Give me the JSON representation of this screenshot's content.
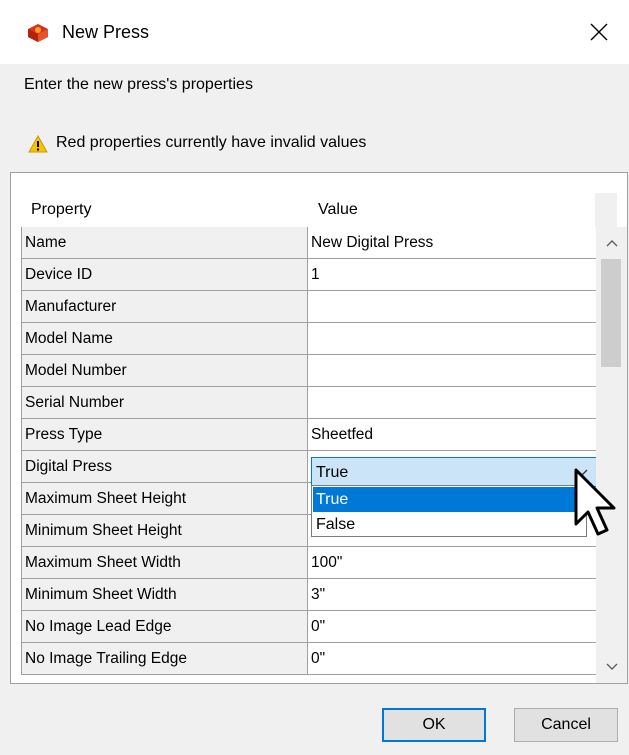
{
  "window": {
    "title": "New Press",
    "close_icon": "close-icon",
    "app_icon": "press-app-icon"
  },
  "subtitle": "Enter the new press's properties",
  "warning": {
    "icon": "warning-icon",
    "text": "Red properties currently have invalid values"
  },
  "table": {
    "headers": {
      "property": "Property",
      "value": "Value"
    },
    "rows": [
      {
        "name": "Name",
        "value": "New Digital Press"
      },
      {
        "name": "Device ID",
        "value": "1"
      },
      {
        "name": "Manufacturer",
        "value": ""
      },
      {
        "name": "Model Name",
        "value": ""
      },
      {
        "name": "Model Number",
        "value": ""
      },
      {
        "name": "Serial Number",
        "value": ""
      },
      {
        "name": "Press Type",
        "value": "Sheetfed"
      },
      {
        "name": "Digital Press",
        "value": "True"
      },
      {
        "name": "Maximum Sheet Height",
        "value": ""
      },
      {
        "name": "Minimum Sheet Height",
        "value": ""
      },
      {
        "name": "Maximum Sheet Width",
        "value": "100\""
      },
      {
        "name": "Minimum Sheet Width",
        "value": "3\""
      },
      {
        "name": "No Image Lead Edge",
        "value": "0\""
      },
      {
        "name": "No Image Trailing Edge",
        "value": "0\""
      }
    ]
  },
  "dropdown": {
    "selected": "True",
    "options": [
      "True",
      "False"
    ],
    "highlighted_option": "True"
  },
  "buttons": {
    "ok": "OK",
    "cancel": "Cancel"
  },
  "colors": {
    "accent": "#0078d7",
    "selection": "#cce4f7",
    "warning": "#f5c400"
  }
}
